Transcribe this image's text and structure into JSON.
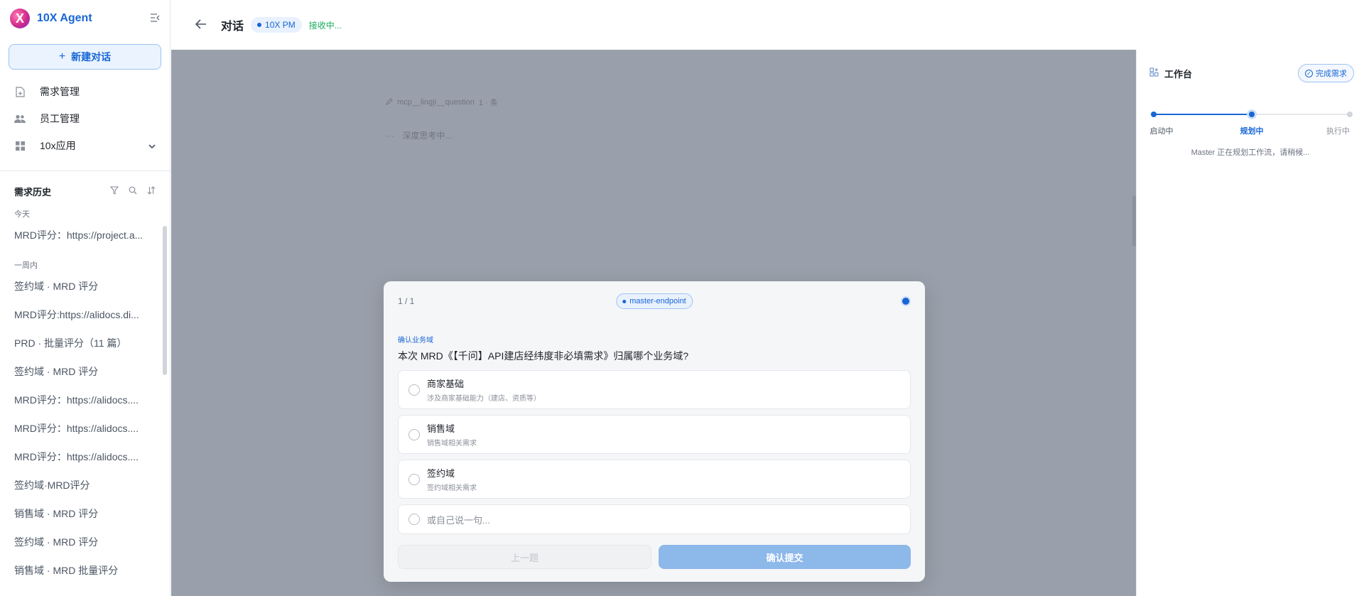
{
  "brand": {
    "logo_letter": "X",
    "name": "10X Agent"
  },
  "sidebar": {
    "new_chat_label": "新建对话",
    "nav": [
      {
        "label": "需求管理",
        "icon": "document-add-icon"
      },
      {
        "label": "员工管理",
        "icon": "users-icon"
      },
      {
        "label": "10x应用",
        "icon": "grid-icon"
      }
    ],
    "history_title": "需求历史",
    "groups": [
      {
        "label": "今天",
        "items": [
          "MRD评分：https://project.a..."
        ]
      },
      {
        "label": "一周内",
        "items": [
          "签约域 · MRD 评分",
          "MRD评分:https://alidocs.di...",
          "PRD · 批量评分（11 篇）",
          "签约域 · MRD 评分",
          "MRD评分：https://alidocs....",
          "MRD评分：https://alidocs....",
          "MRD评分：https://alidocs....",
          "签约域·MRD评分",
          "销售域 · MRD 评分",
          "签约域 · MRD 评分",
          "销售域 · MRD 批量评分"
        ]
      }
    ]
  },
  "topbar": {
    "title": "对话",
    "agent_badge": "10X PM",
    "status": "接收中..."
  },
  "background": {
    "tool_call": "mcp__lingji__question",
    "tool_suffix": "1 · 条",
    "thinking": "深度思考中..."
  },
  "modal": {
    "page_indicator": "1 / 1",
    "endpoint": "master-endpoint",
    "question_tag": "确认业务域",
    "question": "本次 MRD《【千问】API建店经纬度非必填需求》归属哪个业务域?",
    "options": [
      {
        "label": "商家基础",
        "desc": "涉及商家基础能力（建店、资质等）"
      },
      {
        "label": "销售域",
        "desc": "销售域相关需求"
      },
      {
        "label": "签约域",
        "desc": "签约域相关需求"
      }
    ],
    "custom_placeholder": "或自己说一句...",
    "prev_label": "上一题",
    "submit_label": "确认提交"
  },
  "workbench": {
    "title": "工作台",
    "done_label": "完成需求",
    "steps": [
      {
        "label": "启动中",
        "state": "done"
      },
      {
        "label": "规划中",
        "state": "current"
      },
      {
        "label": "执行中",
        "state": "todo"
      }
    ],
    "status": "Master 正在规划工作流，请稍候..."
  },
  "colors": {
    "accent": "#1766d6",
    "overlay": "#9aa0ab",
    "success": "#1aad5a"
  }
}
